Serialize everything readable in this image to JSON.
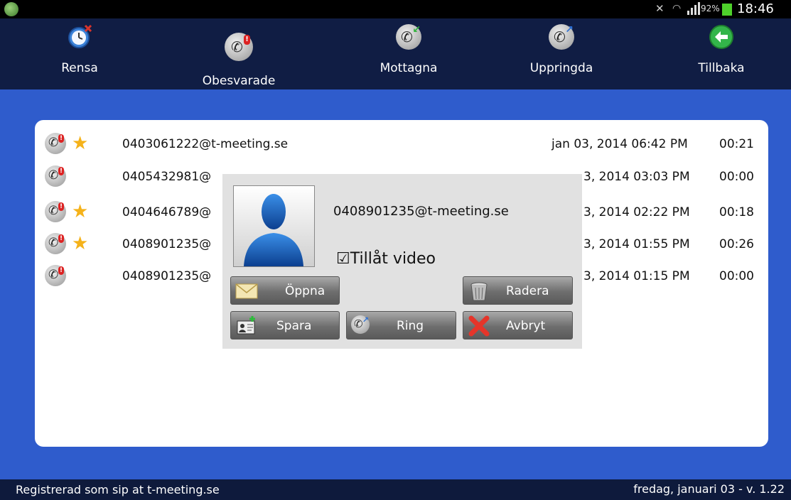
{
  "status_bar": {
    "app_icon": "app-icon",
    "battery_percent": "92%",
    "time": "18:46",
    "icons": [
      "mute-icon",
      "wifi-icon",
      "signal-icon",
      "battery-icon"
    ]
  },
  "toolbar": {
    "items": [
      {
        "label": "Rensa",
        "icon": "clear-history-icon"
      },
      {
        "label": "Obesvarade",
        "icon": "missed-call-icon"
      },
      {
        "label": "Mottagna",
        "icon": "incoming-call-icon"
      },
      {
        "label": "Uppringda",
        "icon": "outgoing-call-icon"
      },
      {
        "label": "Tillbaka",
        "icon": "back-arrow-icon"
      }
    ]
  },
  "calls": [
    {
      "address": "0403061222@t-meeting.se",
      "date": "jan 03, 2014 06:42 PM",
      "duration": "00:21",
      "starred": true
    },
    {
      "address": "0405432981@",
      "date": "3, 2014 03:03 PM",
      "duration": "00:00",
      "starred": false
    },
    {
      "address": "0404646789@",
      "date": "3, 2014 02:22 PM",
      "duration": "00:18",
      "starred": true
    },
    {
      "address": "0408901235@",
      "date": "3, 2014 01:55 PM",
      "duration": "00:26",
      "starred": true
    },
    {
      "address": "0408901235@",
      "date": "3, 2014 01:15 PM",
      "duration": "00:00",
      "starred": false
    }
  ],
  "popup": {
    "address": "0408901235@t-meeting.se",
    "video_checkbox": "☑Tillåt video",
    "buttons": {
      "open": "Öppna",
      "delete": "Radera",
      "save": "Spara",
      "call": "Ring",
      "cancel": "Avbryt"
    }
  },
  "footer": {
    "left": "Registrerad som sip at t-meeting.se",
    "right": "fredag, januari 03 - v. 1.22"
  },
  "colors": {
    "background": "#2f5ccc",
    "toolbar": "#101d44",
    "star": "#f5b21a",
    "missed_mark": "#dd2222"
  }
}
